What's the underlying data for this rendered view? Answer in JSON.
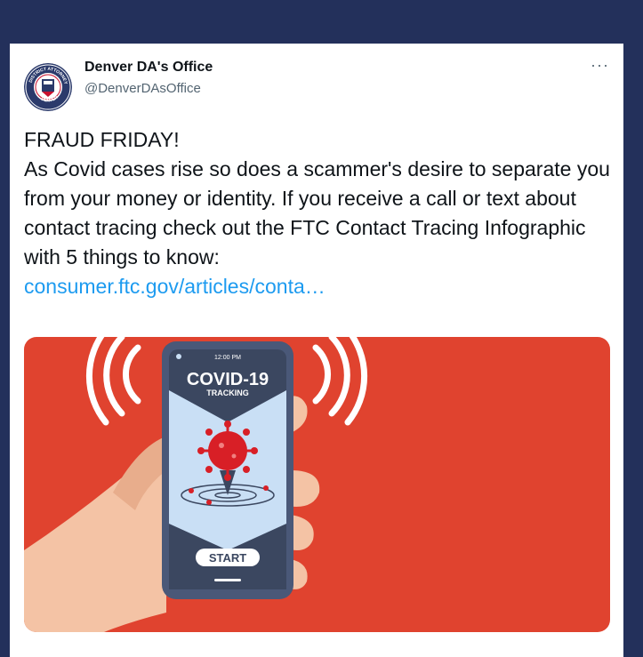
{
  "tweet": {
    "author_name": "Denver DA's Office",
    "author_handle": "@DenverDAsOffice",
    "more_label": "···",
    "text_line1": "FRAUD FRIDAY!",
    "text_body": "As Covid cases rise so does a scammer's desire to separate you from your money or identity.  If you receive a call or text about contact tracing check out the FTC Contact Tracing Infographic with 5 things to know:",
    "link": "consumer.ftc.gov/articles/conta…"
  },
  "media": {
    "phone_time": "12:00 PM",
    "title": "COVID-19",
    "subtitle": "TRACKING",
    "start_label": "START",
    "colors": {
      "background": "#e0432f",
      "phone_body": "#4a5878",
      "screen_top": "#3b4760",
      "screen_mid": "#c9dff5",
      "virus": "#d81f26",
      "hand": "#f4c3a5"
    }
  },
  "avatar": {
    "seal_text_top": "DISTRICT ATTORNEY",
    "seal_text_bottom": "DENVER",
    "colors": {
      "outer": "#2b3a6b",
      "inner": "#c8102e"
    }
  }
}
